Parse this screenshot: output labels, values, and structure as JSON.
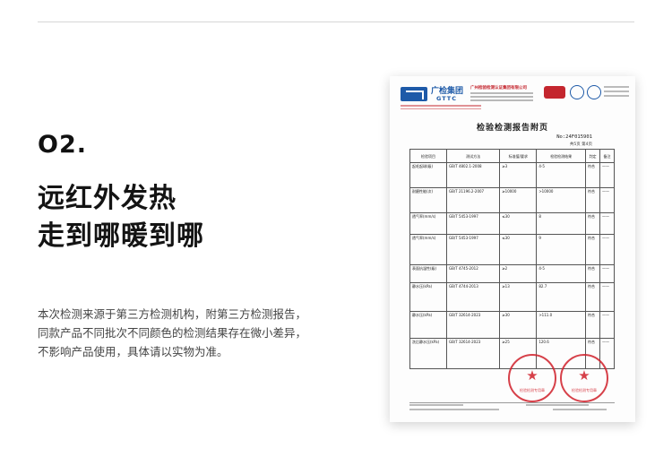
{
  "section": {
    "number": "O2.",
    "title_line1": "远红外发热",
    "title_line2": "走到哪暖到哪",
    "description": [
      "本次检测来源于第三方检测机构，附第三方检测报告，",
      "同款产品不同批次不同颜色的检测结果存在微小差异，",
      "不影响产品使用，具体请以实物为准。"
    ]
  },
  "report": {
    "org_name": "广检集团",
    "org_abbr": "GTTC",
    "institute": "广州检验检测认证集团有限公司",
    "title": "检验检测报告附页",
    "report_no": "No:24F015901",
    "page": "共5页 第4页",
    "table_headers": [
      "检验项目",
      "测试方法",
      "标准值/要求",
      "检验检测结果",
      "判定",
      "备注"
    ],
    "rows": [
      {
        "item": "起毛起球(级)",
        "method": "GB/T 4802.1-2008",
        "standard": "≥3",
        "result": "4-5",
        "verdict": "符合",
        "note": "——"
      },
      {
        "item": "耐磨性能(次)",
        "method": "GB/T 21196.2-2007",
        "standard": "≥10000",
        "result": ">10000",
        "verdict": "符合",
        "note": "——"
      },
      {
        "item": "透气率(mm/s)",
        "method": "GB/T 5453-1997",
        "standard": "≤30",
        "result": "8",
        "verdict": "符合",
        "note": "——"
      },
      {
        "item": "透气率(mm/s)",
        "method": "GB/T 5453-1997",
        "standard": "≤30",
        "result": "9",
        "verdict": "符合",
        "note": "——"
      },
      {
        "item": "表面抗湿性(级)",
        "method": "GB/T 4745-2012",
        "standard": "≥2",
        "result": "4-5",
        "verdict": "符合",
        "note": "——"
      },
      {
        "item": "静水压(kPa)",
        "method": "GB/T 4744-2013",
        "standard": "≥13",
        "result": "82.7",
        "verdict": "符合",
        "note": "——"
      },
      {
        "item": "静水压(kPa)",
        "method": "GB/T 32614-2023",
        "standard": "≥30",
        "result": ">111.0",
        "verdict": "符合",
        "note": "——"
      },
      {
        "item": "洗后静水压(kPa)",
        "method": "GB/T 32614-2023",
        "standard": "≥25",
        "result": "120.6",
        "verdict": "符合",
        "note": "——"
      }
    ]
  }
}
